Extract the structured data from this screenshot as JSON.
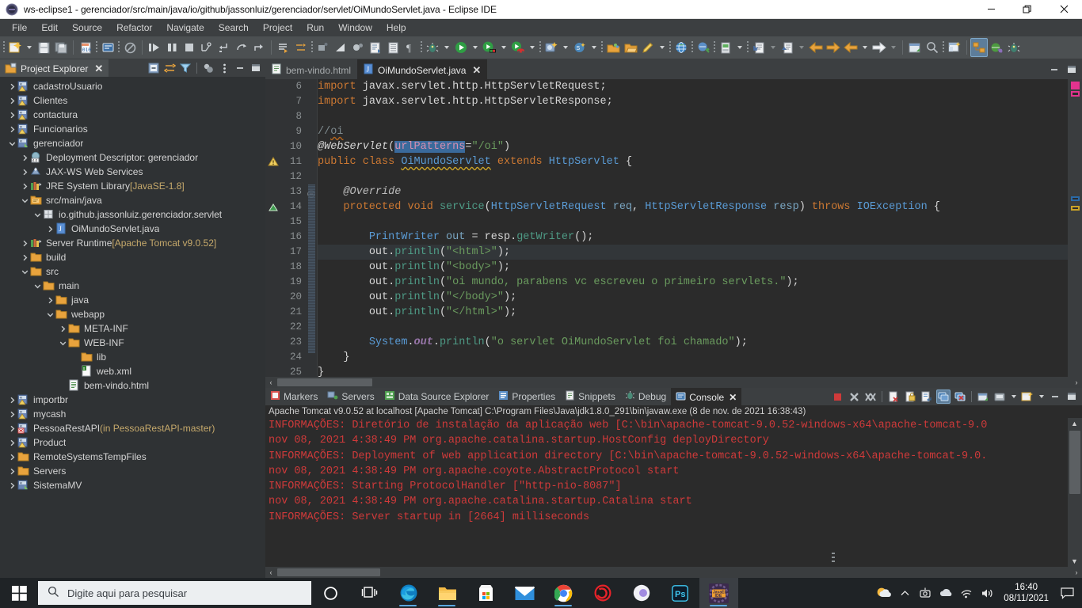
{
  "window": {
    "title": "ws-eclipse1 - gerenciador/src/main/java/io/github/jassonluiz/gerenciador/servlet/OiMundoServlet.java - Eclipse IDE",
    "app_icon": "eclipse-icon",
    "minimize": "—",
    "maximize": "❐",
    "close": "✕"
  },
  "menubar": {
    "items": [
      "File",
      "Edit",
      "Source",
      "Refactor",
      "Navigate",
      "Search",
      "Project",
      "Run",
      "Window",
      "Help"
    ]
  },
  "toolbar": {
    "groups": [
      {
        "buttons": [
          {
            "name": "new-wizard-icon",
            "glyph": "new"
          },
          {
            "name": "new-dropdown-icon",
            "glyph": "caret"
          },
          {
            "name": "save-icon",
            "glyph": "save"
          },
          {
            "name": "save-all-icon",
            "glyph": "saveall"
          }
        ]
      },
      {
        "buttons": [
          {
            "name": "toggle-breakpoint-icon",
            "glyph": "binary"
          },
          {
            "name": "skip-all-breakpoints-icon",
            "glyph": "bluebar"
          },
          {
            "name": "no-debug-icon",
            "glyph": "noentry"
          }
        ]
      },
      {
        "buttons": [
          {
            "name": "resume-icon",
            "glyph": "resume"
          },
          {
            "name": "suspend-icon",
            "glyph": "suspend"
          },
          {
            "name": "terminate-icon",
            "glyph": "terminate"
          },
          {
            "name": "disconnect-icon",
            "glyph": "disconnect"
          },
          {
            "name": "step-into-icon",
            "glyph": "stepinto"
          },
          {
            "name": "step-over-icon",
            "glyph": "stepover"
          },
          {
            "name": "step-return-icon",
            "glyph": "stepreturn"
          }
        ]
      },
      {
        "buttons": [
          {
            "name": "next-annotation-icon",
            "glyph": "nextanno"
          },
          {
            "name": "previous-annotation-icon",
            "glyph": "prevanno"
          }
        ]
      },
      {
        "buttons": [
          {
            "name": "last-edit-location-icon",
            "glyph": "lastedit"
          },
          {
            "name": "coverage-icon",
            "glyph": "coverage"
          },
          {
            "name": "java-browsing-icon",
            "glyph": "browse"
          },
          {
            "name": "open-task-icon",
            "glyph": "opentask"
          },
          {
            "name": "open-type-icon",
            "glyph": "opentype"
          },
          {
            "name": "show-whitespace-icon",
            "glyph": "pilcrow"
          }
        ]
      },
      {
        "buttons": [
          {
            "name": "debug-icon",
            "glyph": "bug"
          },
          {
            "name": "debug-dropdown-icon",
            "glyph": "caret"
          },
          {
            "name": "run-icon",
            "glyph": "run"
          },
          {
            "name": "run-dropdown-icon",
            "glyph": "caret"
          },
          {
            "name": "run-coverage-icon",
            "glyph": "runcov"
          },
          {
            "name": "run-coverage-dropdown-icon",
            "glyph": "caret"
          },
          {
            "name": "run-ant-icon",
            "glyph": "runant"
          },
          {
            "name": "run-ant-dropdown-icon",
            "glyph": "caret"
          }
        ]
      },
      {
        "buttons": [
          {
            "name": "new-server-icon",
            "glyph": "newserver"
          },
          {
            "name": "new-server-dropdown-icon",
            "glyph": "caret"
          },
          {
            "name": "new-ejb-icon",
            "glyph": "ejb"
          },
          {
            "name": "new-ejb-dropdown-icon",
            "glyph": "caret"
          }
        ]
      },
      {
        "buttons": [
          {
            "name": "open-package-icon",
            "glyph": "openpkg"
          },
          {
            "name": "open-folder-icon",
            "glyph": "openfolder"
          },
          {
            "name": "edit-icon",
            "glyph": "pencil"
          },
          {
            "name": "edit-dropdown-icon",
            "glyph": "caret"
          }
        ]
      },
      {
        "buttons": [
          {
            "name": "web-browser-icon",
            "glyph": "globe"
          }
        ]
      },
      {
        "buttons": [
          {
            "name": "new-connection-icon",
            "glyph": "conn"
          }
        ]
      },
      {
        "buttons": [
          {
            "name": "new-database-icon",
            "glyph": "db"
          },
          {
            "name": "new-database-dropdown-icon",
            "glyph": "caret"
          }
        ]
      },
      {
        "buttons": [
          {
            "name": "import-icon",
            "glyph": "import"
          },
          {
            "name": "import-dropdown-icon",
            "glyph": "caret"
          },
          {
            "name": "export-icon",
            "glyph": "export"
          },
          {
            "name": "export-dropdown-icon",
            "glyph": "caret"
          }
        ]
      },
      {
        "buttons": [
          {
            "name": "back-icon",
            "glyph": "backarrow"
          },
          {
            "name": "forward-icon",
            "glyph": "fwdarrow"
          },
          {
            "name": "previous-edit-icon",
            "glyph": "backarrow2"
          },
          {
            "name": "previous-edit-dropdown-icon",
            "glyph": "caret"
          },
          {
            "name": "next-edit-icon",
            "glyph": "whitearrow"
          },
          {
            "name": "next-edit-dropdown-icon",
            "glyph": "caret"
          }
        ]
      },
      {
        "buttons": [
          {
            "name": "new-window-icon",
            "glyph": "newwin"
          },
          {
            "name": "search-icon",
            "glyph": "magnifier"
          }
        ]
      },
      {
        "buttons": [
          {
            "name": "new-perspective-icon",
            "glyph": "newpersp"
          }
        ]
      },
      {
        "buttons": [
          {
            "name": "perspective-java-ee-icon",
            "glyph": "javaee",
            "active": true
          },
          {
            "name": "perspective-web-icon",
            "glyph": "webpersp"
          },
          {
            "name": "perspective-debug-icon",
            "glyph": "debugpersp"
          }
        ]
      }
    ]
  },
  "explorer": {
    "tab_label": "Project Explorer",
    "tab_icon": "project-explorer-icon",
    "tab_close": "✕",
    "tools": [
      {
        "name": "collapse-all-icon"
      },
      {
        "name": "link-with-editor-icon"
      },
      {
        "name": "view-menu-filter-icon"
      },
      {
        "name": "focus-on-active-task-icon"
      },
      {
        "name": "view-menu-icon"
      },
      {
        "name": "minimize-view-icon"
      },
      {
        "name": "maximize-view-icon"
      }
    ],
    "tree": [
      {
        "label": "cadastroUsuario",
        "indent": 0,
        "twist": "›",
        "icon": "java-project-warning-icon"
      },
      {
        "label": "Clientes",
        "indent": 0,
        "twist": "›",
        "icon": "java-project-warning-icon"
      },
      {
        "label": "contactura",
        "indent": 0,
        "twist": "›",
        "icon": "java-project-warning-icon"
      },
      {
        "label": "Funcionarios",
        "indent": 0,
        "twist": "›",
        "icon": "java-project-warning-icon"
      },
      {
        "label": "gerenciador",
        "indent": 0,
        "twist": "⌄",
        "icon": "java-project-icon"
      },
      {
        "label": "Deployment Descriptor: gerenciador",
        "indent": 1,
        "twist": "›",
        "icon": "deployment-descriptor-icon"
      },
      {
        "label": "JAX-WS Web Services",
        "indent": 1,
        "twist": "›",
        "icon": "jaxws-icon"
      },
      {
        "label": "JRE System Library",
        "suffix": "[JavaSE-1.8]",
        "indent": 1,
        "twist": "›",
        "icon": "library-icon"
      },
      {
        "label": "src/main/java",
        "indent": 1,
        "twist": "⌄",
        "icon": "source-folder-icon"
      },
      {
        "label": "io.github.jassonluiz.gerenciador.servlet",
        "indent": 2,
        "twist": "⌄",
        "icon": "package-icon"
      },
      {
        "label": "OiMundoServlet.java",
        "indent": 3,
        "twist": "›",
        "icon": "java-file-icon"
      },
      {
        "label": "Server Runtime",
        "suffix": "[Apache Tomcat v9.0.52]",
        "indent": 1,
        "twist": "›",
        "icon": "library-icon"
      },
      {
        "label": "build",
        "indent": 1,
        "twist": "›",
        "icon": "folder-icon"
      },
      {
        "label": "src",
        "indent": 1,
        "twist": "⌄",
        "icon": "folder-icon"
      },
      {
        "label": "main",
        "indent": 2,
        "twist": "⌄",
        "icon": "folder-icon"
      },
      {
        "label": "java",
        "indent": 3,
        "twist": "›",
        "icon": "folder-icon"
      },
      {
        "label": "webapp",
        "indent": 3,
        "twist": "⌄",
        "icon": "folder-icon"
      },
      {
        "label": "META-INF",
        "indent": 4,
        "twist": "›",
        "icon": "folder-icon"
      },
      {
        "label": "WEB-INF",
        "indent": 4,
        "twist": "⌄",
        "icon": "folder-icon"
      },
      {
        "label": "lib",
        "indent": 5,
        "twist": "",
        "icon": "folder-icon"
      },
      {
        "label": "web.xml",
        "indent": 5,
        "twist": "",
        "icon": "xml-file-icon"
      },
      {
        "label": "bem-vindo.html",
        "indent": 4,
        "twist": "",
        "icon": "html-file-icon"
      },
      {
        "label": "importbr",
        "indent": 0,
        "twist": "›",
        "icon": "java-project-warning-icon"
      },
      {
        "label": "mycash",
        "indent": 0,
        "twist": "›",
        "icon": "java-project-warning-icon"
      },
      {
        "label": "PessoaRestAPI",
        "suffix": "(in PessoaRestAPI-master)",
        "indent": 0,
        "twist": "›",
        "icon": "java-project-error-icon"
      },
      {
        "label": "Product",
        "indent": 0,
        "twist": "›",
        "icon": "java-project-warning-icon"
      },
      {
        "label": "RemoteSystemsTempFiles",
        "indent": 0,
        "twist": "›",
        "icon": "folder-icon"
      },
      {
        "label": "Servers",
        "indent": 0,
        "twist": "›",
        "icon": "folder-icon"
      },
      {
        "label": "SistemaMV",
        "indent": 0,
        "twist": "›",
        "icon": "java-project-icon"
      }
    ]
  },
  "editor": {
    "tabs": [
      {
        "label": "bem-vindo.html",
        "icon": "html-file-icon",
        "active": false,
        "closable": false
      },
      {
        "label": "OiMundoServlet.java",
        "icon": "java-file-icon",
        "active": true,
        "closable": true,
        "close": "✕"
      }
    ],
    "tools": [
      {
        "name": "minimize-editor-icon"
      },
      {
        "name": "maximize-editor-icon"
      }
    ],
    "first_line_number": 6,
    "lines": [
      {
        "n": 6,
        "text": "import javax.servlet.http.HttpServletRequest;"
      },
      {
        "n": 7,
        "text": "import javax.servlet.http.HttpServletResponse;"
      },
      {
        "n": 8,
        "text": ""
      },
      {
        "n": 9,
        "text": "//oi"
      },
      {
        "n": 10,
        "text": "@WebServlet(urlPatterns=\"/oi\")"
      },
      {
        "n": 11,
        "text": "public class OiMundoServlet extends HttpServlet {"
      },
      {
        "n": 12,
        "text": ""
      },
      {
        "n": 13,
        "text": "    @Override"
      },
      {
        "n": 14,
        "text": "    protected void service(HttpServletRequest req, HttpServletResponse resp) throws IOException {"
      },
      {
        "n": 15,
        "text": ""
      },
      {
        "n": 16,
        "text": "        PrintWriter out = resp.getWriter();"
      },
      {
        "n": 17,
        "text": "        out.println(\"<html>\");"
      },
      {
        "n": 18,
        "text": "        out.println(\"<body>\");"
      },
      {
        "n": 19,
        "text": "        out.println(\"oi mundo, parabens vc escreveu o primeiro servlets.\");"
      },
      {
        "n": 20,
        "text": "        out.println(\"</body>\");"
      },
      {
        "n": 21,
        "text": "        out.println(\"</html>\");"
      },
      {
        "n": 22,
        "text": ""
      },
      {
        "n": 23,
        "text": "        System.out.println(\"o servlet OiMundoServlet foi chamado\");"
      },
      {
        "n": 24,
        "text": "    }"
      },
      {
        "n": 25,
        "text": "}"
      }
    ],
    "selected_text": "urlPatterns",
    "warning_line": 11,
    "folding_line": 13,
    "scrollbar": {
      "left_arrow": "‹",
      "right_arrow": "›"
    }
  },
  "console": {
    "tabs": [
      {
        "label": "Markers",
        "icon": "markers-icon",
        "active": false
      },
      {
        "label": "Servers",
        "icon": "servers-icon",
        "active": false
      },
      {
        "label": "Data Source Explorer",
        "icon": "data-source-explorer-icon",
        "active": false
      },
      {
        "label": "Properties",
        "icon": "properties-icon",
        "active": false
      },
      {
        "label": "Snippets",
        "icon": "snippets-icon",
        "active": false
      },
      {
        "label": "Debug",
        "icon": "debug-icon",
        "active": false
      },
      {
        "label": "Console",
        "icon": "console-icon",
        "active": true,
        "close": "✕"
      }
    ],
    "tools": [
      {
        "name": "terminate-console-icon"
      },
      {
        "name": "remove-launch-icon"
      },
      {
        "name": "remove-all-terminated-icon"
      },
      {
        "name": "clear-console-icon"
      },
      {
        "name": "scroll-lock-icon"
      },
      {
        "name": "word-wrap-icon"
      },
      {
        "name": "show-console-on-output-icon"
      },
      {
        "name": "pin-console-icon"
      },
      {
        "name": "display-selected-console-icon"
      },
      {
        "name": "open-console-icon"
      },
      {
        "name": "open-console-dropdown-icon"
      },
      {
        "name": "minimize-console-icon"
      },
      {
        "name": "maximize-console-icon"
      }
    ],
    "header": "Apache Tomcat v9.0.52 at localhost [Apache Tomcat] C:\\Program Files\\Java\\jdk1.8.0_291\\bin\\javaw.exe  (8 de nov. de 2021 16:38:43)",
    "lines": [
      "INFORMAÇÕES: Diretório de instalação da aplicação web [C:\\bin\\apache-tomcat-9.0.52-windows-x64\\apache-tomcat-9.0",
      "nov 08, 2021 4:38:49 PM org.apache.catalina.startup.HostConfig deployDirectory",
      "INFORMAÇÕES: Deployment of web application directory [C:\\bin\\apache-tomcat-9.0.52-windows-x64\\apache-tomcat-9.0.",
      "nov 08, 2021 4:38:49 PM org.apache.coyote.AbstractProtocol start",
      "INFORMAÇÕES: Starting ProtocolHandler [\"http-nio-8087\"]",
      "nov 08, 2021 4:38:49 PM org.apache.catalina.startup.Catalina start",
      "INFORMAÇÕES: Server startup in [2664] milliseconds"
    ],
    "text_color": "#cf3a3a"
  },
  "taskbar": {
    "start_icon": "windows-start-icon",
    "search_placeholder": "Digite aqui para pesquisar",
    "search_icon": "search-icon",
    "buttons": [
      {
        "name": "cortana-icon"
      },
      {
        "name": "task-view-icon"
      },
      {
        "name": "microsoft-edge-icon",
        "running": true
      },
      {
        "name": "file-explorer-icon",
        "running": true
      },
      {
        "name": "microsoft-store-icon",
        "running": false
      },
      {
        "name": "mail-icon",
        "running": false
      },
      {
        "name": "google-chrome-icon",
        "running": true
      },
      {
        "name": "opera-gx-icon",
        "running": false
      },
      {
        "name": "media-player-icon",
        "running": false
      },
      {
        "name": "photoshop-icon",
        "running": false
      },
      {
        "name": "eclipse-ide-icon",
        "running": true,
        "active": true
      }
    ],
    "tray": [
      {
        "name": "weather-icon"
      },
      {
        "name": "show-hidden-icons-icon",
        "glyph": "⌃"
      },
      {
        "name": "screen-capture-icon"
      },
      {
        "name": "onedrive-icon"
      },
      {
        "name": "network-icon"
      },
      {
        "name": "volume-icon"
      }
    ],
    "time": "16:40",
    "date": "08/11/2021",
    "notifications_icon": "notifications-icon"
  },
  "colors": {
    "accent": "#5a9bd5",
    "console_text": "#cf3a3a",
    "titlebar_bg": "#ffffff",
    "chrome_bg": "#4c5052",
    "editor_bg": "#2b2b2b",
    "tree_bg": "#2f3234",
    "taskbar_bg": "#1f2326"
  }
}
